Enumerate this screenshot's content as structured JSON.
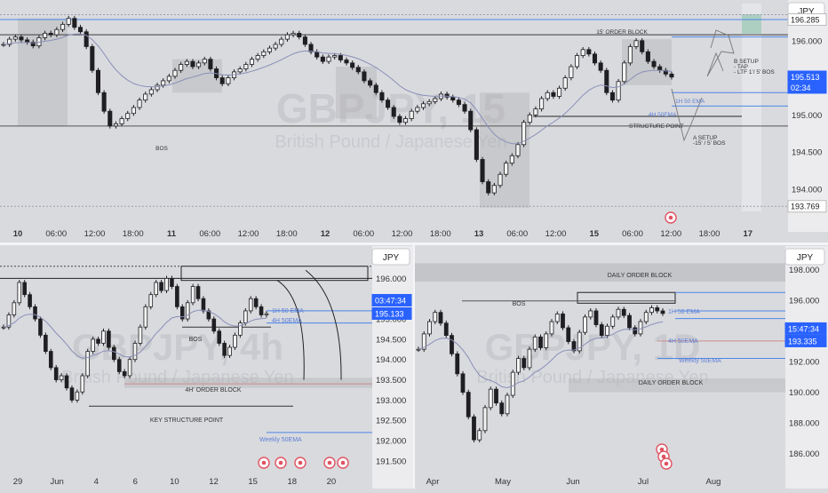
{
  "colors": {
    "panel_bg": "#d9dade",
    "candle": "#1f1f22",
    "zone": "#a9aaad",
    "blue_line": "#4d86e8",
    "ema_line": "#8a8fb8",
    "price_badge": "#2962ff",
    "bos_line": "#3a3a3e"
  },
  "currency_label": "JPY",
  "chart_data": [
    {
      "type": "line",
      "panel": "top",
      "title": "GBPJPY, 15",
      "subtitle": "British Pound / Japanese Yen",
      "currency": "JPY",
      "y_ticks": [
        "196.000",
        "195.500",
        "195.000",
        "194.500",
        "194.000"
      ],
      "ylim": [
        193.7,
        196.5
      ],
      "x_ticks": [
        "10",
        "06:00",
        "12:00",
        "18:00",
        "11",
        "06:00",
        "12:00",
        "18:00",
        "12",
        "06:00",
        "12:00",
        "18:00",
        "13",
        "06:00",
        "12:00",
        "15",
        "06:00",
        "12:00",
        "18:00",
        "17"
      ],
      "price_tags": [
        {
          "label": "196.285",
          "value": 196.285,
          "style": "light"
        },
        {
          "label": "195.513",
          "value": 195.513,
          "style": "blue"
        },
        {
          "label": "02:34",
          "value": 195.4,
          "style": "blue"
        },
        {
          "label": "193.769",
          "value": 193.769,
          "style": "light"
        }
      ],
      "annotations": [
        "15' ORDER BLOCK",
        "BOS",
        "STRUCTURE POINT",
        "1H 50 EMA",
        "4H 50EMA",
        "B SETUP",
        "- TAP",
        "- LTF 1'/ 5' BOS",
        "A SETUP",
        "-15' / 5' BOS"
      ],
      "series": [
        {
          "values": [
            195.95,
            196.02,
            196.05,
            196.01,
            195.98,
            195.93,
            196.04,
            196.1,
            196.08,
            196.15,
            196.22,
            196.3,
            196.18,
            196.12,
            195.92,
            195.6,
            195.3,
            195.05,
            194.85,
            194.88,
            194.95,
            195.02,
            195.1,
            195.2,
            195.28,
            195.34,
            195.4,
            195.46,
            195.52,
            195.6,
            195.68,
            195.72,
            195.65,
            195.7,
            195.75,
            195.62,
            195.5,
            195.42,
            195.5,
            195.58,
            195.62,
            195.68,
            195.75,
            195.8,
            195.85,
            195.9,
            195.95,
            196.02,
            196.08,
            196.1,
            196.05,
            195.95,
            195.85,
            195.78,
            195.72,
            195.78,
            195.8,
            195.74,
            195.7,
            195.64,
            195.58,
            195.46,
            195.4,
            195.3,
            195.2,
            195.1,
            194.98,
            194.9,
            194.95,
            195.05,
            195.1,
            195.15,
            195.18,
            195.22,
            195.28,
            195.24,
            195.2,
            195.14,
            195.05,
            194.8,
            194.4,
            194.1,
            193.95,
            194.05,
            194.2,
            194.35,
            194.45,
            194.6,
            194.9,
            195.0,
            195.08,
            195.22,
            195.3,
            195.25,
            195.36,
            195.5,
            195.65,
            195.8,
            195.88,
            195.82,
            195.7,
            195.6,
            195.3,
            195.2,
            195.45,
            195.7,
            195.92,
            196.0,
            195.85,
            195.72,
            195.65,
            195.6,
            195.55,
            195.51
          ]
        }
      ]
    },
    {
      "type": "line",
      "panel": "bottom-left",
      "title": "GBPJPY, 4h",
      "subtitle": "British Pound / Japanese Yen",
      "currency": "JPY",
      "y_ticks": [
        "196.000",
        "195.500",
        "195.000",
        "194.500",
        "194.000",
        "193.500",
        "193.000",
        "192.500",
        "192.000",
        "191.500"
      ],
      "ylim": [
        191.3,
        196.6
      ],
      "x_ticks": [
        "29",
        "Jun",
        "4",
        "6",
        "10",
        "12",
        "15",
        "18",
        "20"
      ],
      "price_tags": [
        {
          "label": "03:47:34",
          "value": 195.4,
          "style": "blue"
        },
        {
          "label": "195.133",
          "value": 195.133,
          "style": "blue"
        }
      ],
      "annotations": [
        "BOS",
        "4H' ORDER BLOCK",
        "KEY STRUCTURE POINT",
        "1H 50 EMA",
        "4H 50EMA",
        "Weekly 50EMA"
      ],
      "series": [
        {
          "values": [
            194.8,
            195.1,
            195.4,
            195.9,
            195.6,
            195.3,
            195.0,
            194.6,
            194.2,
            193.8,
            193.5,
            193.6,
            193.3,
            193.0,
            193.2,
            193.6,
            194.2,
            194.5,
            194.4,
            194.7,
            194.3,
            194.0,
            193.7,
            193.6,
            194.0,
            194.4,
            194.8,
            195.3,
            195.6,
            195.9,
            195.7,
            196.0,
            195.8,
            195.3,
            195.0,
            195.4,
            195.8,
            195.5,
            195.2,
            195.0,
            194.7,
            194.4,
            194.1,
            194.3,
            194.6,
            194.9,
            195.2,
            195.5,
            195.3,
            195.1,
            195.13
          ]
        }
      ]
    },
    {
      "type": "line",
      "panel": "bottom-right",
      "title": "GBPJPY, 1D",
      "subtitle": "British Pound / Japanese Yen",
      "currency": "JPY",
      "y_ticks": [
        "198.000",
        "196.000",
        "194.000",
        "192.000",
        "190.000",
        "188.000",
        "186.000"
      ],
      "ylim": [
        185.0,
        199.0
      ],
      "x_ticks": [
        "Apr",
        "May",
        "Jun",
        "Jul",
        "Aug"
      ],
      "price_tags": [
        {
          "label": "15:47:34",
          "value": 195.35,
          "style": "blue"
        },
        {
          "label": "193.335",
          "value": 193.335,
          "style": "blue"
        }
      ],
      "annotations": [
        "DAILY ORDER BLOCK",
        "BOS",
        "DAILY ORDER BLOCK",
        "Weekly 50EMA",
        "1H 50 EMA",
        "4H 50EMA"
      ],
      "series": [
        {
          "values": [
            192.8,
            193.8,
            194.6,
            195.2,
            194.5,
            193.7,
            192.5,
            191.2,
            190.0,
            188.4,
            186.9,
            187.5,
            189.0,
            190.2,
            189.3,
            188.6,
            189.8,
            191.3,
            192.2,
            191.6,
            192.8,
            193.6,
            192.9,
            193.8,
            194.6,
            195.1,
            194.2,
            193.3,
            192.7,
            193.9,
            194.9,
            195.3,
            194.4,
            193.7,
            194.3,
            194.9,
            195.4,
            195.0,
            194.2,
            193.8,
            194.6,
            195.2,
            195.5,
            195.3,
            195.13
          ]
        }
      ]
    }
  ]
}
